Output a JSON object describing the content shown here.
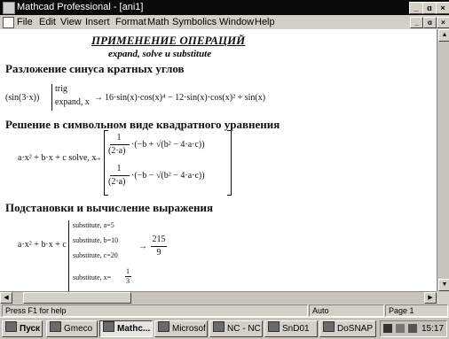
{
  "window": {
    "title": "Mathcad Professional - [ani1]",
    "controls": [
      "_",
      "ɑ",
      "×"
    ]
  },
  "menu": [
    "File",
    "Edit",
    "View",
    "Insert",
    "Format",
    "Math",
    "Symbolics",
    "Window",
    "Help"
  ],
  "document_controls": [
    "_",
    "ɑ",
    "×"
  ],
  "worksheet": {
    "title": "ПРИМЕНЕНИЕ ОПЕРАЦИЙ",
    "subtitle": "expand, solve и substitute",
    "section1": {
      "heading": "Разложение синуса кратных углов",
      "expr": "(sin(3·x))",
      "keyword1": "trig",
      "keyword2": "expand, x",
      "arrow": "→",
      "result": "16·sin(x)·cos(x)⁴ − 12·sin(x)·cos(x)² + sin(x)"
    },
    "section2": {
      "heading": "Решение в символьном виде квадратного уравнения",
      "expr": "a·x² + b·x + c solve, x",
      "arrow": "→",
      "row1_num": "1",
      "row1_den": "(2·a)",
      "row1_body": "·(−b + √(b² − 4·a·c))",
      "row2_num": "1",
      "row2_den": "(2·a)",
      "row2_body": "·(−b − √(b² − 4·a·c))"
    },
    "section3": {
      "heading": "Подстановки и вычисление выражения",
      "expr": "a·x² + b·x + c",
      "sub1": "substitute, a=5",
      "sub2": "substitute, b=10",
      "sub3": "substitute, c=20",
      "sub4": "substitute, x=",
      "sub4_num": "1",
      "sub4_den": "3",
      "arrow": "→",
      "result_num": "215",
      "result_den": "9"
    }
  },
  "status": {
    "help": "Press F1 for help",
    "mode": "Auto",
    "page": "Page 1"
  },
  "taskbar": {
    "items": [
      "Пуск",
      "Gmeco",
      "Mathc...",
      "Microsof",
      "NC - NC",
      "SnD01",
      "DoSNAP"
    ],
    "active_index": 2,
    "clock": "15:17"
  }
}
